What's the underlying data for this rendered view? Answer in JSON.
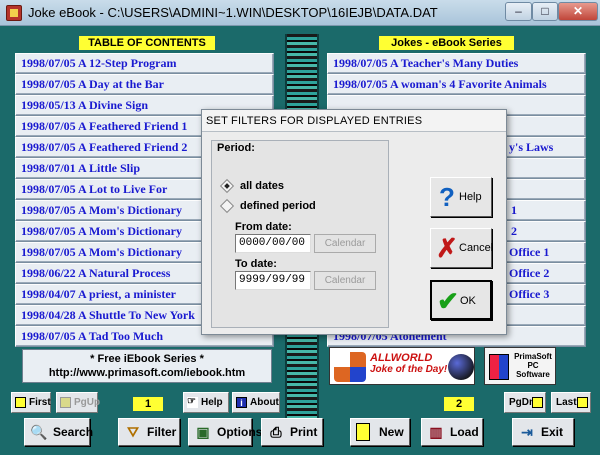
{
  "window": {
    "title": "Joke eBook - C:\\USERS\\ADMINI~1.WIN\\DESKTOP\\16IEJB\\DATA.DAT",
    "minimize_glyph": "–",
    "maximize_glyph": "□",
    "close_glyph": "✕"
  },
  "toc": {
    "header": "TABLE OF CONTENTS",
    "items": [
      "1998/07/05  A 12-Step Program",
      "1998/07/05  A Day at the Bar",
      "1998/05/13  A Divine Sign",
      "1998/07/05  A Feathered Friend 1",
      "1998/07/05  A Feathered Friend 2",
      "1998/07/01  A Little Slip",
      "1998/07/05  A Lot to Live For",
      "1998/07/05  A Mom's Dictionary",
      "1998/07/05  A Mom's Dictionary",
      "1998/07/05  A Mom's Dictionary",
      "1998/06/22  A Natural Process",
      "1998/04/07  A priest, a minister",
      "1998/04/28  A Shuttle To New York",
      "1998/07/05  A Tad Too Much"
    ]
  },
  "jokes": {
    "header": "Jokes - eBook Series",
    "items": [
      "1998/07/05  A Teacher's Many Duties",
      "1998/07/05  A woman's 4 Favorite Animals",
      "",
      "",
      "y's Laws",
      "",
      "",
      "1",
      "2",
      "Office 1",
      "Office 2",
      "Office 3",
      "1998/07/05  As Good As It Gets",
      "1998/07/05  Atonement"
    ]
  },
  "promo": {
    "line1": "* Free iEbook Series *",
    "line2": "http://www.primasoft.com/iebook.htm"
  },
  "logos": {
    "allworld_name": "ALLWORLD",
    "allworld_tagline": "Joke of the Day!",
    "primasoft_line1": "PrimaSoft",
    "primasoft_line2": "PC",
    "primasoft_line3": "Software"
  },
  "nav": {
    "first": "First",
    "pgup": "PgUp",
    "page_left": "1",
    "help": "Help",
    "about": "About",
    "page_right": "2",
    "pgdn": "PgDn",
    "last": "Last"
  },
  "toolbar": {
    "search": "Search",
    "filter": "Filter",
    "options": "Options",
    "print": "Print",
    "new": "New",
    "load": "Load",
    "exit": "Exit"
  },
  "dialog": {
    "title": "SET FILTERS FOR DISPLAYED ENTRIES",
    "period_label": "Period:",
    "option_all": "all dates",
    "option_defined": "defined period",
    "selected_option": "all dates",
    "from_label": "From date:",
    "from_value": "0000/00/00",
    "to_label": "To date:",
    "to_value": "9999/99/99",
    "calendar_label": "Calendar",
    "help_label": "Help",
    "cancel_label": "Cancel",
    "ok_label": "OK"
  },
  "colors": {
    "background": "#1b6a6a",
    "highlight_yellow": "#ffff33",
    "entry_text": "#1a1ad0"
  }
}
